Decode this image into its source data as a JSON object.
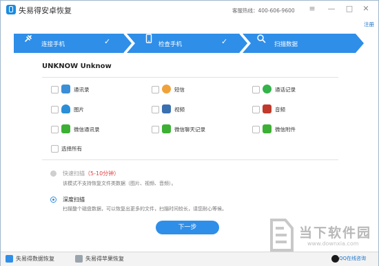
{
  "app": {
    "title": "失易得安卓恢复",
    "hotline": "客服热线：400-606-9600",
    "register": "注册"
  },
  "steps": [
    {
      "label": "连接手机",
      "check": "✓"
    },
    {
      "label": "检查手机",
      "check": "✓"
    },
    {
      "label": "扫描数据"
    }
  ],
  "device": {
    "name": "UNKNOW Unknow"
  },
  "options": [
    {
      "label": "通讯录",
      "icon": "contacts-icon",
      "color": "#3a8fd6"
    },
    {
      "label": "短信",
      "icon": "sms-icon",
      "color": "#f0a23a"
    },
    {
      "label": "通话记录",
      "icon": "phone-icon",
      "color": "#33b34a"
    },
    {
      "label": "图片",
      "icon": "photo-icon",
      "color": "#2b8ed8"
    },
    {
      "label": "视频",
      "icon": "video-icon",
      "color": "#3a6fb0"
    },
    {
      "label": "音频",
      "icon": "audio-icon",
      "color": "#c0392b"
    },
    {
      "label": "微信通讯录",
      "icon": "wechat-icon",
      "color": "#3cb034"
    },
    {
      "label": "微信聊天记录",
      "icon": "wechat-icon",
      "color": "#3cb034"
    },
    {
      "label": "微信附件",
      "icon": "wechat-icon",
      "color": "#3cb034"
    }
  ],
  "select_all": "选择所有",
  "scan": {
    "quick": {
      "title": "快速扫描",
      "duration": "（5-10分钟）",
      "desc": "该模式不支持恢复文件类数据（图片、视频、音频）。"
    },
    "deep": {
      "title": "深度扫描",
      "desc": "扫描整个磁盘数据，可以恢复出更多的文件，扫描时间较长，请您耐心等候。"
    }
  },
  "next_button": "下一步",
  "bottom": {
    "data_recovery": "失易得数据恢复",
    "apple_recovery": "失易得苹果恢复",
    "qq": "QQ在线咨询"
  },
  "watermark": {
    "text": "当下软件园",
    "url": "www.downxia.com"
  },
  "colors": {
    "accent": "#2f8ee8",
    "step_bg": "#2f8ee8"
  }
}
